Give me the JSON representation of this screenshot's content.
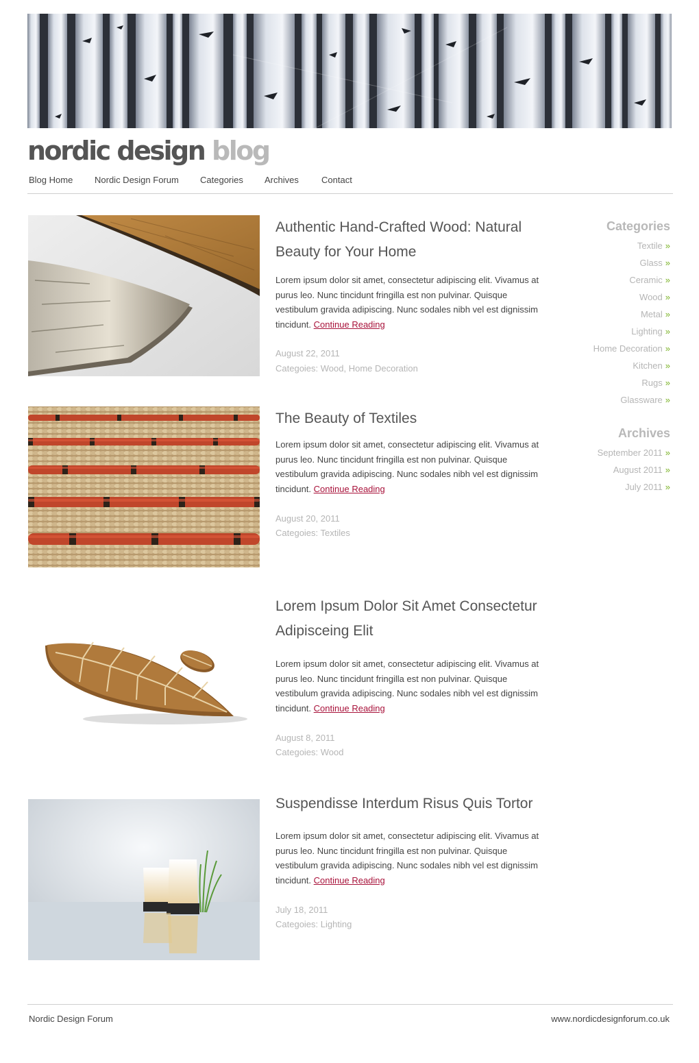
{
  "site": {
    "logo_primary": "nordic design",
    "logo_secondary": "blog"
  },
  "nav": {
    "items": [
      {
        "label": "Blog Home"
      },
      {
        "label": "Nordic Design Forum"
      },
      {
        "label": "Categories"
      },
      {
        "label": "Archives"
      },
      {
        "label": "Contact"
      }
    ]
  },
  "posts": [
    {
      "title": "Authentic Hand-Crafted Wood: Natural Beauty for Your Home",
      "excerpt": "Lorem ipsum dolor sit amet, consectetur adipiscing elit. Vivamus at purus leo. Nunc tincidunt fringilla est non pulvinar. Quisque vestibulum gravida adipiscing. Nunc sodales nibh vel est dignissim tincidunt.",
      "read_more": "Continue Reading",
      "date": "August 22, 2011",
      "categories": "Categoies: Wood, Home Decoration",
      "image": "wood-bowls-image"
    },
    {
      "title": "The Beauty of Textiles",
      "excerpt": "Lorem ipsum dolor sit amet, consectetur adipiscing elit. Vivamus at purus leo. Nunc tincidunt fringilla est non pulvinar. Quisque vestibulum gravida adipiscing. Nunc sodales nibh vel est dignissim tincidunt.",
      "read_more": "Continue Reading",
      "date": "August 20, 2011",
      "categories": "Categoies: Textiles",
      "image": "woven-textile-image"
    },
    {
      "title": "Lorem Ipsum Dolor Sit Amet Consectetur Adipisceing Elit",
      "excerpt": "Lorem ipsum dolor sit amet, consectetur adipiscing elit. Vivamus at purus leo. Nunc tincidunt fringilla est non pulvinar. Quisque vestibulum gravida adipiscing. Nunc sodales nibh vel est dignissim tincidunt.",
      "read_more": "Continue Reading",
      "date": "August 8, 2011",
      "categories": "Categoies: Wood",
      "image": "wooden-leaf-tray-image"
    },
    {
      "title": "Suspendisse Interdum Risus Quis Tortor",
      "excerpt": "Lorem ipsum dolor sit amet, consectetur adipiscing elit. Vivamus at purus leo. Nunc tincidunt fringilla est non pulvinar. Quisque vestibulum gravida adipiscing. Nunc sodales nibh vel est dignissim tincidunt.",
      "read_more": "Continue Reading",
      "date": "July 18, 2011",
      "categories": "Categoies: Lighting",
      "image": "candle-lanterns-image"
    }
  ],
  "sidebar": {
    "categories_title": "Categories",
    "categories": [
      "Textile",
      "Glass",
      "Ceramic",
      "Wood",
      "Metal",
      "Lighting",
      "Home Decoration",
      "Kitchen",
      "Rugs",
      "Glassware"
    ],
    "archives_title": "Archives",
    "archives": [
      "September 2011",
      "August 2011",
      "July 2011"
    ],
    "arrow": "»"
  },
  "footer": {
    "left": "Nordic Design Forum",
    "right": "www.nordicdesignforum.co.uk"
  },
  "colors": {
    "link_accent": "#a8123a",
    "arrow_accent": "#7bb326",
    "muted_text": "#b5b5b5"
  }
}
